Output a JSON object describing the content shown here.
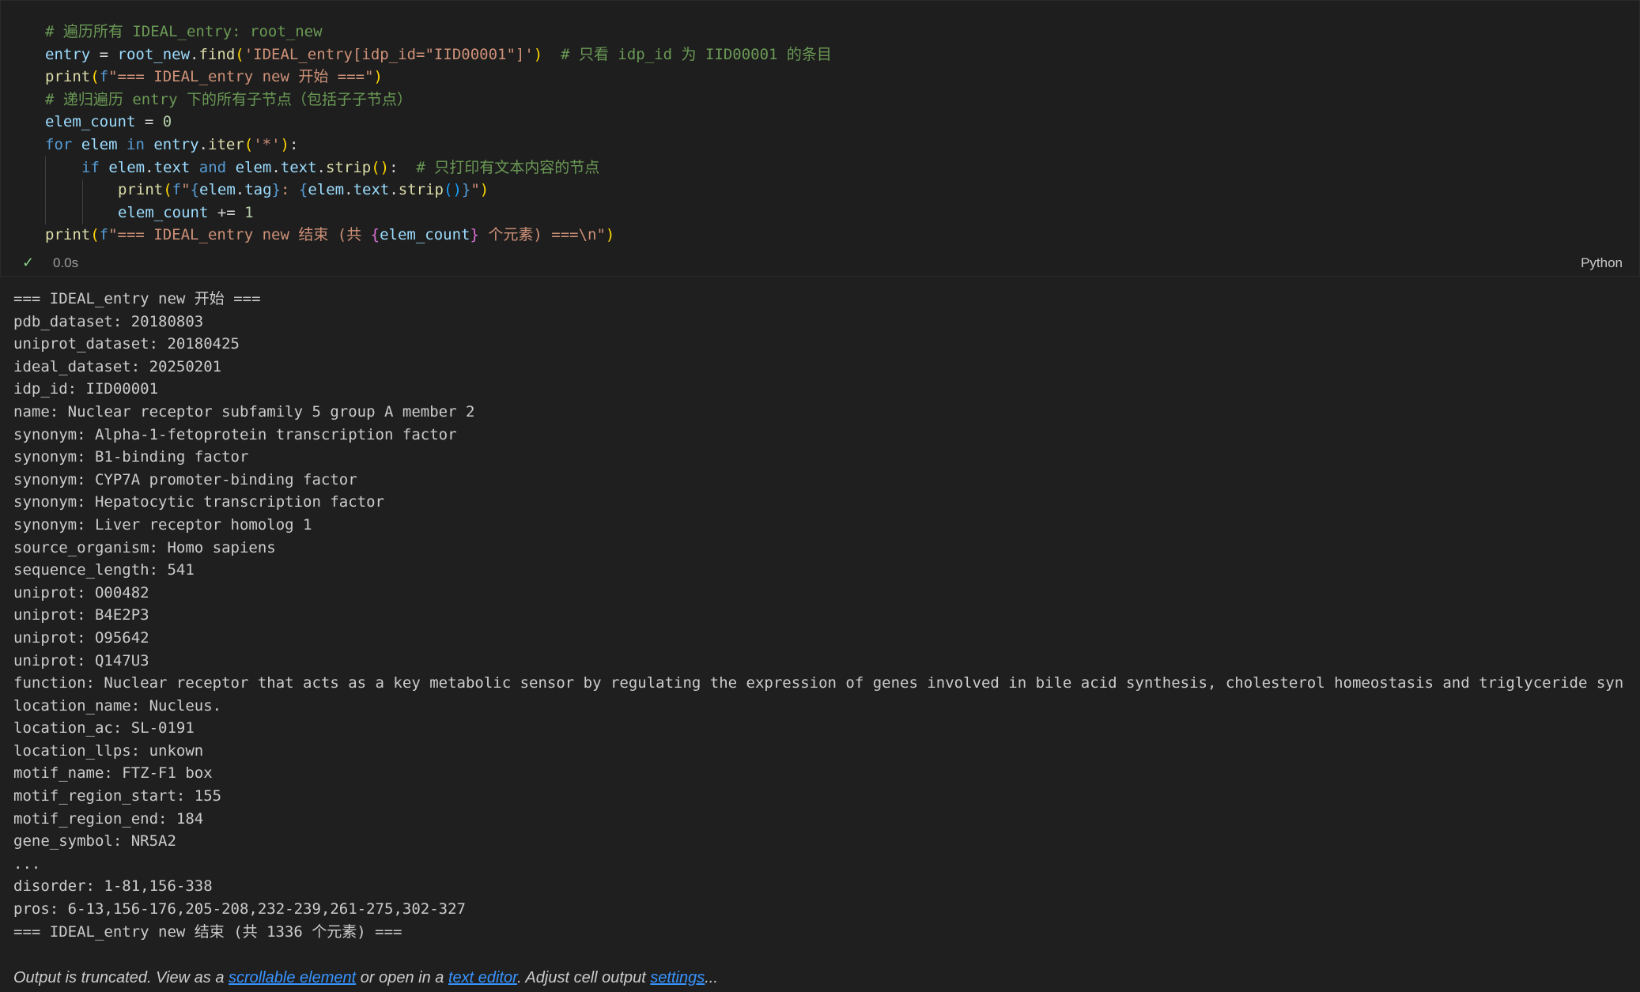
{
  "cell": {
    "code_lines": [
      {
        "indent": 0,
        "tokens": [
          {
            "c": "cm",
            "t": "# 遍历所有 IDEAL_entry: root_new"
          }
        ]
      },
      {
        "indent": 0,
        "tokens": [
          {
            "c": "id",
            "t": "entry"
          },
          {
            "c": "op",
            "t": " = "
          },
          {
            "c": "id",
            "t": "root_new"
          },
          {
            "c": "op",
            "t": "."
          },
          {
            "c": "fn",
            "t": "find"
          },
          {
            "c": "br1",
            "t": "("
          },
          {
            "c": "st",
            "t": "'IDEAL_entry[idp_id=\"IID00001\"]'"
          },
          {
            "c": "br1",
            "t": ")"
          },
          {
            "c": "op",
            "t": "  "
          },
          {
            "c": "cm",
            "t": "# 只看 idp_id 为 IID00001 的条目"
          }
        ]
      },
      {
        "indent": 0,
        "tokens": [
          {
            "c": "fn",
            "t": "print"
          },
          {
            "c": "br1",
            "t": "("
          },
          {
            "c": "kw",
            "t": "f"
          },
          {
            "c": "st",
            "t": "\"=== IDEAL_entry new 开始 ===\""
          },
          {
            "c": "br1",
            "t": ")"
          }
        ]
      },
      {
        "indent": 0,
        "tokens": [
          {
            "c": "cm",
            "t": "# 递归遍历 entry 下的所有子节点（包括子子节点）"
          }
        ]
      },
      {
        "indent": 0,
        "tokens": [
          {
            "c": "id",
            "t": "elem_count"
          },
          {
            "c": "op",
            "t": " = "
          },
          {
            "c": "nm",
            "t": "0"
          }
        ]
      },
      {
        "indent": 0,
        "tokens": [
          {
            "c": "kw",
            "t": "for"
          },
          {
            "c": "op",
            "t": " "
          },
          {
            "c": "id",
            "t": "elem"
          },
          {
            "c": "op",
            "t": " "
          },
          {
            "c": "kw",
            "t": "in"
          },
          {
            "c": "op",
            "t": " "
          },
          {
            "c": "id",
            "t": "entry"
          },
          {
            "c": "op",
            "t": "."
          },
          {
            "c": "fn",
            "t": "iter"
          },
          {
            "c": "br1",
            "t": "("
          },
          {
            "c": "st",
            "t": "'*'"
          },
          {
            "c": "br1",
            "t": ")"
          },
          {
            "c": "op",
            "t": ":"
          }
        ]
      },
      {
        "indent": 1,
        "tokens": [
          {
            "c": "kw",
            "t": "if"
          },
          {
            "c": "op",
            "t": " "
          },
          {
            "c": "id",
            "t": "elem"
          },
          {
            "c": "op",
            "t": "."
          },
          {
            "c": "id",
            "t": "text"
          },
          {
            "c": "op",
            "t": " "
          },
          {
            "c": "kw",
            "t": "and"
          },
          {
            "c": "op",
            "t": " "
          },
          {
            "c": "id",
            "t": "elem"
          },
          {
            "c": "op",
            "t": "."
          },
          {
            "c": "id",
            "t": "text"
          },
          {
            "c": "op",
            "t": "."
          },
          {
            "c": "fn",
            "t": "strip"
          },
          {
            "c": "br1",
            "t": "()"
          },
          {
            "c": "op",
            "t": ":  "
          },
          {
            "c": "cm",
            "t": "# 只打印有文本内容的节点"
          }
        ]
      },
      {
        "indent": 2,
        "tokens": [
          {
            "c": "fn",
            "t": "print"
          },
          {
            "c": "br1",
            "t": "("
          },
          {
            "c": "kw",
            "t": "f"
          },
          {
            "c": "st",
            "t": "\""
          },
          {
            "c": "kw",
            "t": "{"
          },
          {
            "c": "id",
            "t": "elem"
          },
          {
            "c": "op",
            "t": "."
          },
          {
            "c": "id",
            "t": "tag"
          },
          {
            "c": "kw",
            "t": "}"
          },
          {
            "c": "st",
            "t": ": "
          },
          {
            "c": "kw",
            "t": "{"
          },
          {
            "c": "id",
            "t": "elem"
          },
          {
            "c": "op",
            "t": "."
          },
          {
            "c": "id",
            "t": "text"
          },
          {
            "c": "op",
            "t": "."
          },
          {
            "c": "fn",
            "t": "strip"
          },
          {
            "c": "br3",
            "t": "()"
          },
          {
            "c": "kw",
            "t": "}"
          },
          {
            "c": "st",
            "t": "\""
          },
          {
            "c": "br1",
            "t": ")"
          }
        ]
      },
      {
        "indent": 2,
        "tokens": [
          {
            "c": "id",
            "t": "elem_count"
          },
          {
            "c": "op",
            "t": " += "
          },
          {
            "c": "nm",
            "t": "1"
          }
        ]
      },
      {
        "indent": 0,
        "tokens": [
          {
            "c": "fn",
            "t": "print"
          },
          {
            "c": "br1",
            "t": "("
          },
          {
            "c": "kw",
            "t": "f"
          },
          {
            "c": "st",
            "t": "\"=== IDEAL_entry new 结束 (共 "
          },
          {
            "c": "br2",
            "t": "{"
          },
          {
            "c": "id",
            "t": "elem_count"
          },
          {
            "c": "br2",
            "t": "}"
          },
          {
            "c": "st",
            "t": " 个元素) ===\\n\""
          },
          {
            "c": "br1",
            "t": ")"
          }
        ]
      }
    ],
    "status_check": "✓",
    "exec_time": "0.0s",
    "language": "Python"
  },
  "output": {
    "lines": [
      "=== IDEAL_entry new 开始 ===",
      "pdb_dataset: 20180803",
      "uniprot_dataset: 20180425",
      "ideal_dataset: 20250201",
      "idp_id: IID00001",
      "name: Nuclear receptor subfamily 5 group A member 2",
      "synonym: Alpha-1-fetoprotein transcription factor",
      "synonym: B1-binding factor",
      "synonym: CYP7A promoter-binding factor",
      "synonym: Hepatocytic transcription factor",
      "synonym: Liver receptor homolog 1",
      "source_organism: Homo sapiens",
      "sequence_length: 541",
      "uniprot: O00482",
      "uniprot: B4E2P3",
      "uniprot: O95642",
      "uniprot: Q147U3",
      "function: Nuclear receptor that acts as a key metabolic sensor by regulating the expression of genes involved in bile acid synthesis, cholesterol homeostasis and triglyceride syn",
      "location_name: Nucleus.",
      "location_ac: SL-0191",
      "location_llps: unkown",
      "motif_name: FTZ-F1 box",
      "motif_region_start: 155",
      "motif_region_end: 184",
      "gene_symbol: NR5A2",
      "...",
      "disorder: 1-81,156-338",
      "pros: 6-13,156-176,205-208,232-239,261-275,302-327",
      "=== IDEAL_entry new 结束 (共 1336 个元素) ==="
    ]
  },
  "truncation": {
    "prefix": "Output is truncated. View as a ",
    "link1": "scrollable element",
    "mid1": " or open in a ",
    "link2": "text editor",
    "mid2": ". Adjust cell output ",
    "link3": "settings",
    "suffix": "..."
  }
}
